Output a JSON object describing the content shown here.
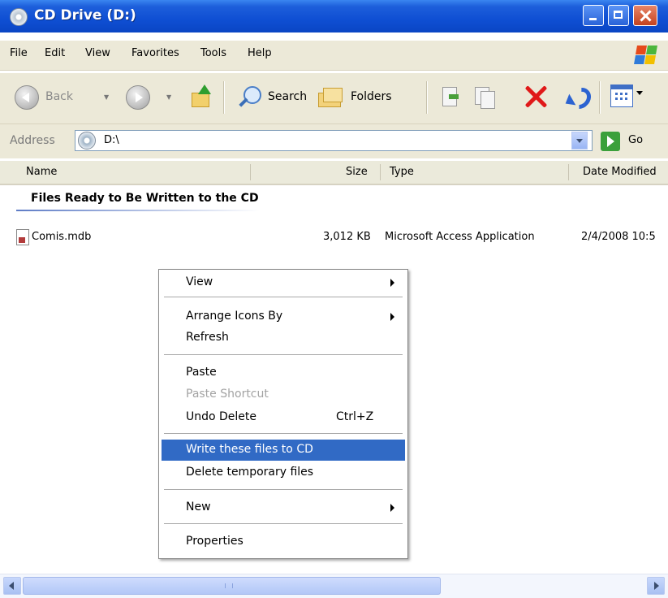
{
  "window": {
    "title": "CD Drive (D:)"
  },
  "menubar": {
    "items": [
      "File",
      "Edit",
      "View",
      "Favorites",
      "Tools",
      "Help"
    ]
  },
  "toolbar": {
    "back": "Back",
    "search": "Search",
    "folders": "Folders"
  },
  "address": {
    "label": "Address",
    "value": "D:\\",
    "go": "Go"
  },
  "columns": {
    "name": "Name",
    "size": "Size",
    "type": "Type",
    "date": "Date Modified"
  },
  "group": {
    "heading": "Files Ready to Be Written to the CD"
  },
  "files": [
    {
      "name": "Comis.mdb",
      "size": "3,012 KB",
      "type": "Microsoft Access Application",
      "date": "2/4/2008 10:5"
    }
  ],
  "context_menu": {
    "view": "View",
    "arrange": "Arrange Icons By",
    "refresh": "Refresh",
    "paste": "Paste",
    "paste_shortcut": "Paste Shortcut",
    "undo_delete": "Undo Delete",
    "undo_shortcut": "Ctrl+Z",
    "write_cd": "Write these files to CD",
    "delete_temp": "Delete temporary files",
    "new": "New",
    "properties": "Properties"
  },
  "colors": {
    "titlebar": "#0f4fd3",
    "selection": "#316ac5",
    "chrome": "#ece9d8"
  },
  "icons": [
    "cd-drive-icon",
    "back-icon",
    "forward-icon",
    "up-folder-icon",
    "search-icon",
    "folders-icon",
    "move-to-icon",
    "copy-to-icon",
    "delete-icon",
    "undo-icon",
    "views-icon",
    "go-icon",
    "windows-logo-icon",
    "file-icon"
  ]
}
